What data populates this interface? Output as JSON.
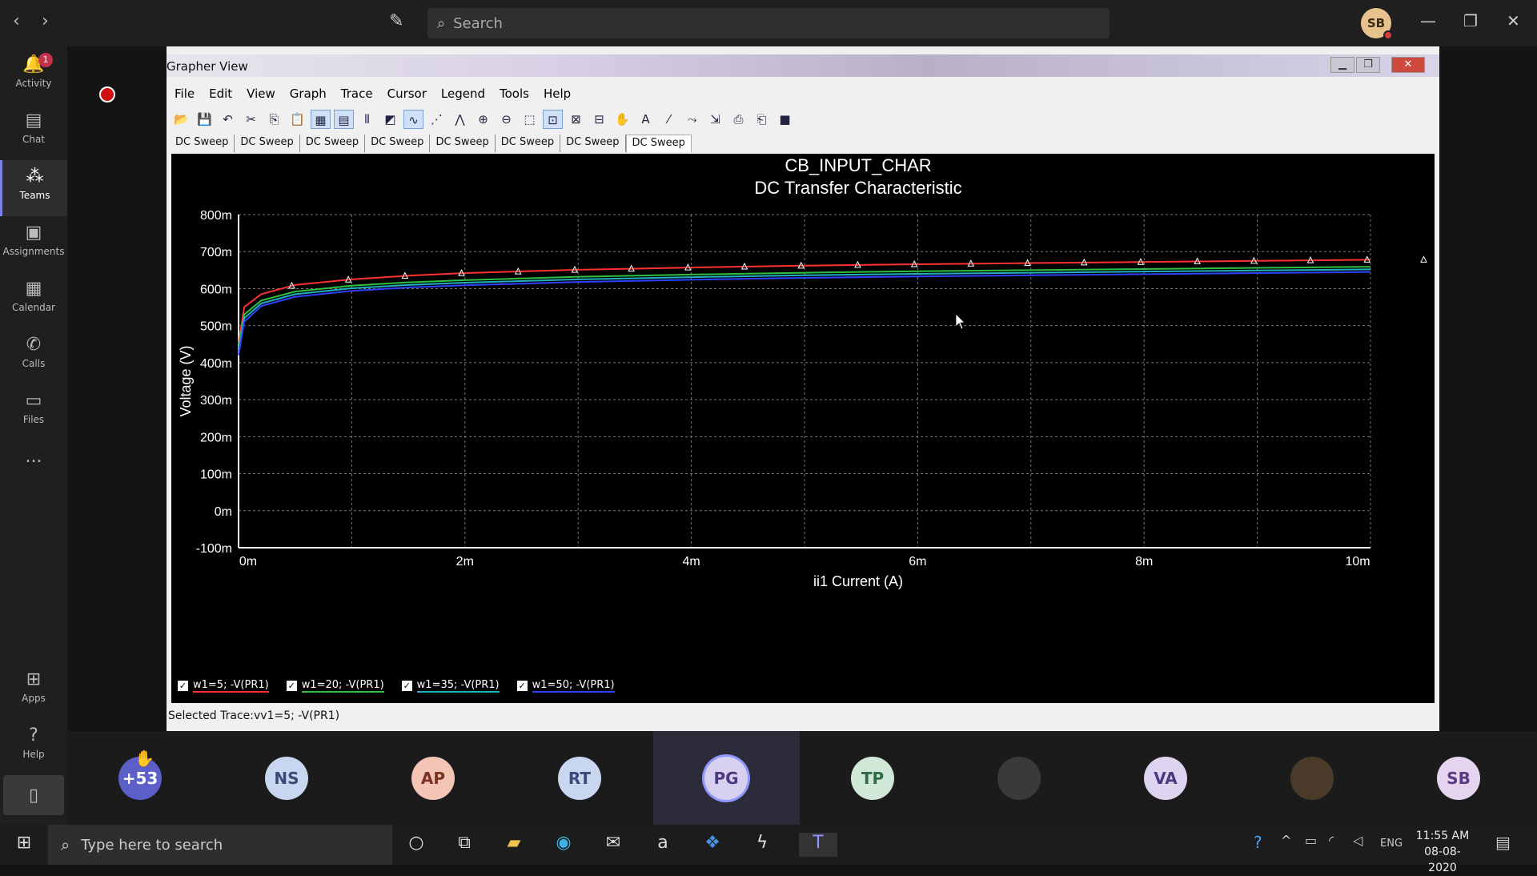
{
  "teams": {
    "search_placeholder": "Search",
    "user_initials": "SB",
    "rail": [
      {
        "label": "Activity",
        "icon": "bell-icon",
        "badge": "1"
      },
      {
        "label": "Chat",
        "icon": "chat-icon"
      },
      {
        "label": "Teams",
        "icon": "teams-icon",
        "active": true
      },
      {
        "label": "Assignments",
        "icon": "assignments-icon"
      },
      {
        "label": "Calendar",
        "icon": "calendar-icon"
      },
      {
        "label": "Calls",
        "icon": "phone-icon"
      },
      {
        "label": "Files",
        "icon": "files-icon"
      },
      {
        "label": "...",
        "icon": "more-icon"
      }
    ],
    "rail_bottom": [
      {
        "label": "Apps",
        "icon": "apps-icon"
      },
      {
        "label": "Help",
        "icon": "help-icon"
      }
    ]
  },
  "grapher": {
    "window_title": "Grapher View",
    "menus": [
      "File",
      "Edit",
      "View",
      "Graph",
      "Trace",
      "Cursor",
      "Legend",
      "Tools",
      "Help"
    ],
    "tabs": [
      "DC Sweep",
      "DC Sweep",
      "DC Sweep",
      "DC Sweep",
      "DC Sweep",
      "DC Sweep",
      "DC Sweep",
      "DC Sweep"
    ],
    "status": "Selected Trace:vv1=5; -V(PR1)"
  },
  "chart_data": {
    "type": "line",
    "title": "CB_INPUT_CHAR",
    "subtitle": "DC Transfer Characteristic",
    "xlabel": "ii1 Current (A)",
    "ylabel": "Voltage (V)",
    "xlim": [
      0,
      0.01
    ],
    "ylim": [
      -0.1,
      0.8
    ],
    "x_ticks": [
      "0m",
      "2m",
      "4m",
      "6m",
      "8m",
      "10m"
    ],
    "y_ticks": [
      "800m",
      "700m",
      "600m",
      "500m",
      "400m",
      "300m",
      "200m",
      "100m",
      "0m",
      "-100m"
    ],
    "grid": true,
    "legend_position": "bottom-left",
    "x": [
      0,
      5e-05,
      0.0002,
      0.0005,
      0.001,
      0.0015,
      0.002,
      0.003,
      0.004,
      0.005,
      0.006,
      0.007,
      0.008,
      0.009,
      0.01
    ],
    "series": [
      {
        "name": "w1=5; -V(PR1)",
        "color": "#ff3030",
        "values": [
          0.45,
          0.55,
          0.585,
          0.61,
          0.625,
          0.635,
          0.642,
          0.651,
          0.657,
          0.662,
          0.666,
          0.669,
          0.672,
          0.675,
          0.678
        ]
      },
      {
        "name": "w1=20; -V(PR1)",
        "color": "#30c040",
        "values": [
          0.44,
          0.53,
          0.568,
          0.592,
          0.608,
          0.617,
          0.623,
          0.632,
          0.638,
          0.643,
          0.647,
          0.65,
          0.653,
          0.656,
          0.659
        ]
      },
      {
        "name": "w1=35; -V(PR1)",
        "color": "#20b0c0",
        "values": [
          0.43,
          0.52,
          0.56,
          0.585,
          0.601,
          0.61,
          0.616,
          0.625,
          0.631,
          0.636,
          0.64,
          0.643,
          0.646,
          0.649,
          0.652
        ]
      },
      {
        "name": "w1=50; -V(PR1)",
        "color": "#3040ff",
        "values": [
          0.42,
          0.51,
          0.553,
          0.578,
          0.594,
          0.603,
          0.609,
          0.618,
          0.624,
          0.629,
          0.633,
          0.636,
          0.639,
          0.642,
          0.645
        ]
      }
    ]
  },
  "participants": [
    {
      "initials": "+53",
      "color": "#5b5fc7",
      "text": "#fff",
      "hand": true
    },
    {
      "initials": "NS",
      "color": "#c9d6f0",
      "text": "#3a4a78"
    },
    {
      "initials": "AP",
      "color": "#f4c5b7",
      "text": "#7a3322"
    },
    {
      "initials": "RT",
      "color": "#c9d6f0",
      "text": "#3a4a78"
    },
    {
      "initials": "PG",
      "color": "#d8d0f0",
      "text": "#4a3a80",
      "active": true
    },
    {
      "initials": "TP",
      "color": "#cfe8d8",
      "text": "#2e6a44"
    },
    {
      "initials": "",
      "color": "#3a3a3a",
      "text": "#fff",
      "photo": true
    },
    {
      "initials": "VA",
      "color": "#ddd5f0",
      "text": "#4a3a80"
    },
    {
      "initials": "",
      "color": "#4a3a2a",
      "text": "#fff",
      "photo": true
    },
    {
      "initials": "SB",
      "color": "#e4d4f0",
      "text": "#5a3a80"
    }
  ],
  "taskbar": {
    "search_placeholder": "Type here to search",
    "time": "11:55 AM",
    "date": "08-08-2020",
    "lang": "ENG"
  }
}
